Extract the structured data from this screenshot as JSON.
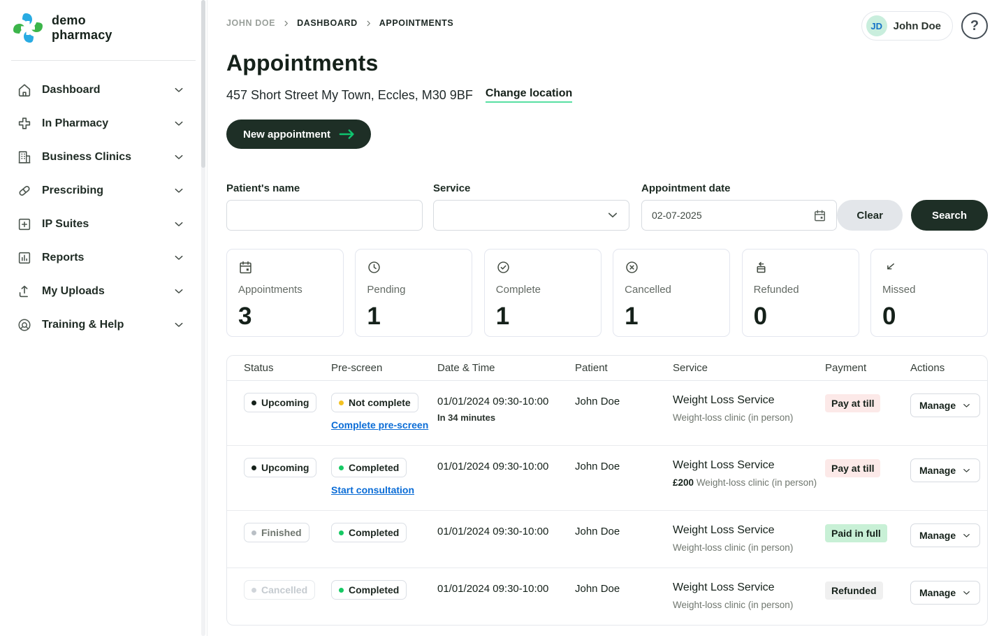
{
  "brand": {
    "line1": "demo",
    "line2": "pharmacy",
    "logo_colors": {
      "green": "#3cb54a",
      "blue": "#29abe2"
    }
  },
  "sidebar": {
    "items": [
      {
        "label": "Dashboard",
        "icon": "home-icon"
      },
      {
        "label": "In Pharmacy",
        "icon": "pharmacy-cross-icon"
      },
      {
        "label": "Business Clinics",
        "icon": "building-icon"
      },
      {
        "label": "Prescribing",
        "icon": "pill-icon"
      },
      {
        "label": "IP Suites",
        "icon": "plus-square-icon"
      },
      {
        "label": "Reports",
        "icon": "bar-chart-icon"
      },
      {
        "label": "My Uploads",
        "icon": "upload-icon"
      },
      {
        "label": "Training & Help",
        "icon": "lifebuoy-icon"
      }
    ]
  },
  "header": {
    "breadcrumb": [
      "JOHN DOE",
      "DASHBOARD",
      "APPOINTMENTS"
    ],
    "user": {
      "initials": "JD",
      "name": "John Doe"
    },
    "help_label": "?",
    "title": "Appointments",
    "address": "457 Short Street My Town, Eccles, M30 9BF",
    "change_location_label": "Change location",
    "new_appointment_label": "New appointment"
  },
  "filters": {
    "patient_name_label": "Patient's name",
    "patient_name_value": "",
    "service_label": "Service",
    "service_value": "",
    "date_label": "Appointment date",
    "date_value": "02-07-2025",
    "clear_label": "Clear",
    "search_label": "Search"
  },
  "stats": [
    {
      "label": "Appointments",
      "value": "3",
      "icon": "calendar-icon"
    },
    {
      "label": "Pending",
      "value": "1",
      "icon": "clock-icon"
    },
    {
      "label": "Complete",
      "value": "1",
      "icon": "check-circle-icon"
    },
    {
      "label": "Cancelled",
      "value": "1",
      "icon": "x-circle-icon"
    },
    {
      "label": "Refunded",
      "value": "0",
      "icon": "refund-card-icon"
    },
    {
      "label": "Missed",
      "value": "0",
      "icon": "missed-arrow-icon"
    }
  ],
  "table": {
    "headers": [
      "Status",
      "Pre-screen",
      "Date & Time",
      "Patient",
      "Service",
      "Payment",
      "Actions"
    ],
    "manage_label": "Manage",
    "rows": [
      {
        "status": "Upcoming",
        "status_variant": "dark",
        "prescreen": "Not complete",
        "prescreen_variant": "amber",
        "prescreen_link": "Complete pre-screen",
        "datetime": "01/01/2024 09:30-10:00",
        "time_note": "In 34 minutes",
        "patient": "John Doe",
        "service": "Weight Loss Service",
        "service_price": "",
        "service_detail": "Weight-loss clinic (in person)",
        "payment": "Pay at till",
        "payment_variant": "pink"
      },
      {
        "status": "Upcoming",
        "status_variant": "dark",
        "prescreen": "Completed",
        "prescreen_variant": "green",
        "prescreen_link": "Start consultation",
        "datetime": "01/01/2024 09:30-10:00",
        "time_note": "",
        "patient": "John Doe",
        "service": "Weight Loss Service",
        "service_price": "£200",
        "service_detail": "Weight-loss clinic (in person)",
        "payment": "Pay at till",
        "payment_variant": "pink"
      },
      {
        "status": "Finished",
        "status_variant": "gray",
        "prescreen": "Completed",
        "prescreen_variant": "green",
        "prescreen_link": "",
        "datetime": "01/01/2024 09:30-10:00",
        "time_note": "",
        "patient": "John Doe",
        "service": "Weight Loss Service",
        "service_price": "",
        "service_detail": "Weight-loss clinic (in person)",
        "payment": "Paid in full",
        "payment_variant": "green"
      },
      {
        "status": "Cancelled",
        "status_variant": "faded",
        "prescreen": "Completed",
        "prescreen_variant": "green",
        "prescreen_link": "",
        "datetime": "01/01/2024 09:30-10:00",
        "time_note": "",
        "patient": "John Doe",
        "service": "Weight Loss Service",
        "service_price": "",
        "service_detail": "Weight-loss clinic (in person)",
        "payment": "Refunded",
        "payment_variant": "gray"
      }
    ]
  },
  "colors": {
    "accent_green": "#0fc56f",
    "underline_green": "#57dfa2",
    "dark_button": "#1e2f26",
    "link_blue": "#0a6cd6",
    "badge_pink_bg": "#fce9e8",
    "badge_green_bg": "#c8f0d6",
    "badge_gray_bg": "#f0f0f0",
    "amber_dot": "#f3c223",
    "green_dot": "#17c964",
    "avatar_bg": "#c9eedd",
    "avatar_text": "#1472c8"
  }
}
